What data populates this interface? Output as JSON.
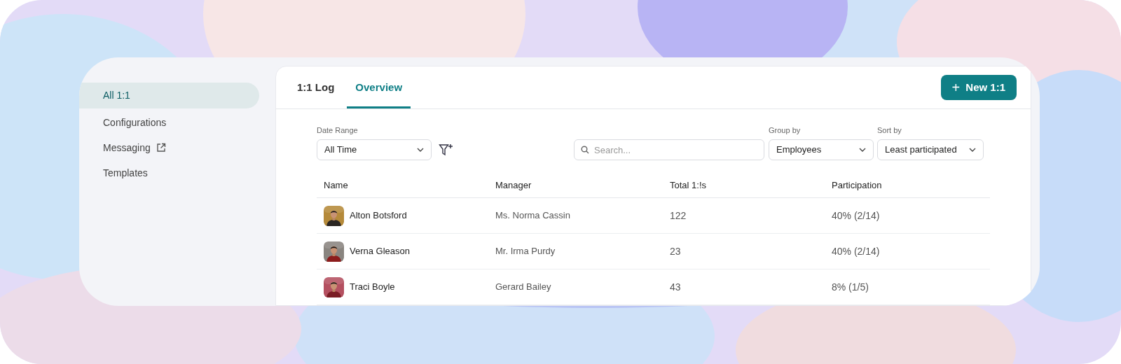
{
  "sidebar": {
    "items": [
      {
        "label": "All 1:1",
        "selected": true,
        "external": false
      },
      {
        "label": "Configurations",
        "selected": false,
        "external": false
      },
      {
        "label": "Messaging",
        "selected": false,
        "external": true
      },
      {
        "label": "Templates",
        "selected": false,
        "external": false
      }
    ]
  },
  "tabs": [
    {
      "label": "1:1 Log",
      "selected": false
    },
    {
      "label": "Overview",
      "selected": true
    }
  ],
  "new_button": {
    "icon": "+",
    "label": "New 1:1"
  },
  "filters": {
    "date_range": {
      "label": "Date Range",
      "value": "All Time"
    },
    "search": {
      "placeholder": "Search..."
    },
    "group_by": {
      "label": "Group by",
      "value": "Employees"
    },
    "sort_by": {
      "label": "Sort by",
      "value": "Least participated"
    }
  },
  "table": {
    "columns": [
      "Name",
      "Manager",
      "Total 1:!s",
      "Participation"
    ],
    "rows": [
      {
        "name": "Alton Botsford",
        "manager": "Ms. Norma Cassin",
        "total": "122",
        "participation": "40% (2/14)"
      },
      {
        "name": "Verna Gleason",
        "manager": "Mr. Irma Purdy",
        "total": "23",
        "participation": "40% (2/14)"
      },
      {
        "name": "Traci Boyle",
        "manager": "Gerard Bailey",
        "total": "43",
        "participation": "8% (1/5)"
      }
    ]
  }
}
